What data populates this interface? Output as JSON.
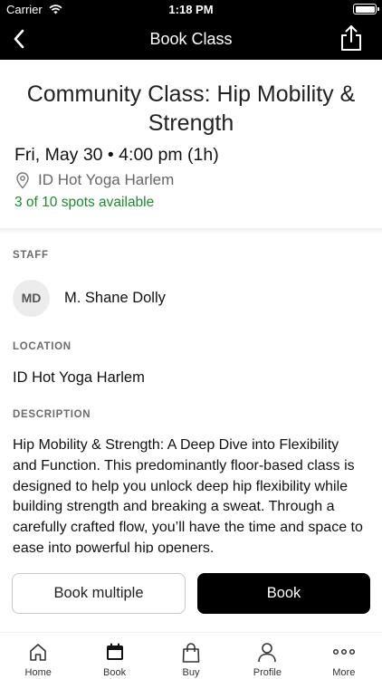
{
  "status_bar": {
    "carrier": "Carrier",
    "time": "1:18 PM"
  },
  "nav": {
    "title": "Book Class",
    "back_icon": "chevron-left-icon",
    "share_icon": "share-icon"
  },
  "class_info": {
    "title": "Community Class: Hip Mobility & Strength",
    "date_time": "Fri, May 30 • 4:00 pm (1h)",
    "location": "ID Hot Yoga Harlem",
    "spots": "3 of 10 spots available",
    "spots_color": "#1f8a2e"
  },
  "staff": {
    "label": "STAFF",
    "initials": "MD",
    "name": "M. Shane Dolly"
  },
  "location_section": {
    "label": "LOCATION",
    "value": "ID Hot Yoga Harlem"
  },
  "description_section": {
    "label": "DESCRIPTION",
    "text": "Hip Mobility & Strength: A Deep Dive into Flexibility and Function. This predominantly floor-based class is designed to help you unlock deep hip flexibility while building strength and breaking a sweat. Through a carefully crafted flow, you’ll have the time and space to ease into powerful hip openers."
  },
  "actions": {
    "book_multiple": "Book multiple",
    "book": "Book"
  },
  "tabs": [
    {
      "label": "Home",
      "icon": "home-icon"
    },
    {
      "label": "Book",
      "icon": "calendar-icon",
      "active": true
    },
    {
      "label": "Buy",
      "icon": "shopping-bag-icon"
    },
    {
      "label": "Profile",
      "icon": "profile-icon"
    },
    {
      "label": "More",
      "icon": "more-dots-icon"
    }
  ]
}
